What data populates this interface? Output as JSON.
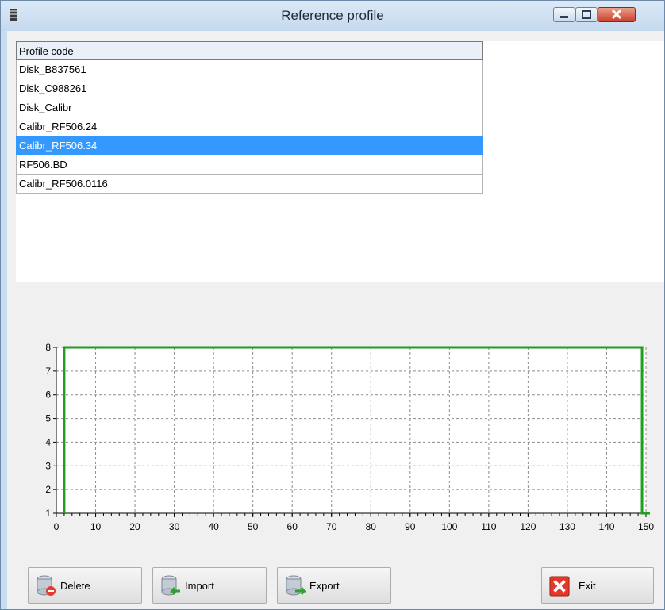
{
  "window": {
    "title": "Reference profile"
  },
  "profiles": {
    "header": "Profile code",
    "items": [
      "Disk_B837561",
      "Disk_C988261",
      "Disk_Calibr",
      "Calibr_RF506.24",
      "Calibr_RF506.34",
      "RF506.BD",
      "Calibr_RF506.0116"
    ],
    "selected_index": 4
  },
  "chart_data": {
    "type": "line",
    "title": "",
    "xlabel": "",
    "ylabel": "",
    "xlim": [
      0,
      150
    ],
    "ylim": [
      1,
      8
    ],
    "xticks": [
      "0",
      "10",
      "20",
      "30",
      "40",
      "50",
      "60",
      "70",
      "80",
      "90",
      "100",
      "110",
      "120",
      "130",
      "140",
      "150"
    ],
    "yticks": [
      "1",
      "2",
      "3",
      "4",
      "5",
      "6",
      "7",
      "8"
    ],
    "grid": true,
    "series": [
      {
        "color": "#1f9e1f",
        "x": [
          2,
          2,
          149,
          149,
          151
        ],
        "y": [
          1,
          8,
          8,
          1,
          1
        ]
      }
    ]
  },
  "buttons": {
    "delete": "Delete",
    "import": "Import",
    "export": "Export",
    "exit": "Exit"
  },
  "colors": {
    "selection": "#3399ff",
    "series": "#1f9e1f"
  }
}
